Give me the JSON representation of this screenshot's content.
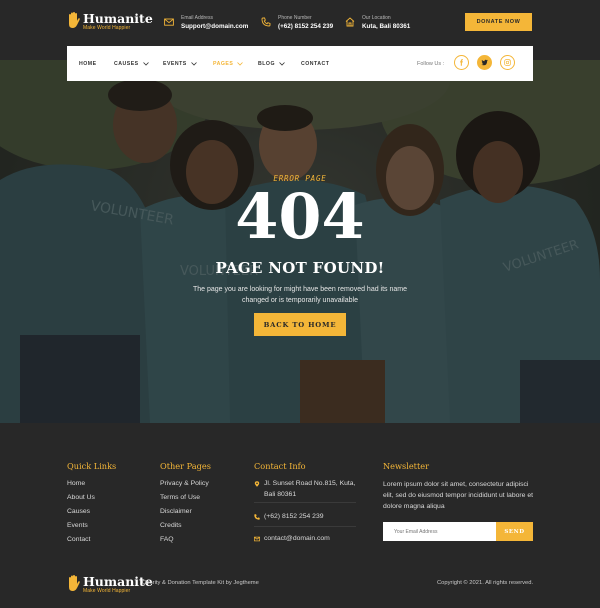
{
  "brand": {
    "name": "Humanite",
    "tagline": "Make World Happier",
    "accent": "#f4b638"
  },
  "topbar": {
    "email": {
      "icon": "mail-icon",
      "label": "Email Address",
      "value": "Support@domain.com"
    },
    "phone": {
      "icon": "phone-icon",
      "label": "Phone Number",
      "value": "(+62) 8152 254 239"
    },
    "location": {
      "icon": "home-icon",
      "label": "Our Location",
      "value": "Kuta, Bali 80361"
    },
    "donate_label": "DONATE NOW"
  },
  "nav": {
    "items": [
      {
        "label": "HOME",
        "dropdown": false,
        "active": false
      },
      {
        "label": "CAUSES",
        "dropdown": true,
        "active": false
      },
      {
        "label": "EVENTS",
        "dropdown": true,
        "active": false
      },
      {
        "label": "PAGES",
        "dropdown": true,
        "active": true
      },
      {
        "label": "BLOG",
        "dropdown": true,
        "active": false
      },
      {
        "label": "CONTACT",
        "dropdown": false,
        "active": false
      }
    ],
    "follow_label": "Follow Us :",
    "socials": [
      "facebook-icon",
      "twitter-icon",
      "instagram-icon"
    ]
  },
  "hero": {
    "eyebrow": "ERROR PAGE",
    "code": "404",
    "title": "PAGE NOT FOUND!",
    "description": "The page you are looking for might have been removed had its name changed or is temporarily unavailable",
    "button_label": "BACK TO HOME",
    "shirt_text": "VOLUNTEER"
  },
  "footer": {
    "quick_links": {
      "title": "Quick Links",
      "items": [
        "Home",
        "About Us",
        "Causes",
        "Events",
        "Contact"
      ]
    },
    "other_pages": {
      "title": "Other Pages",
      "items": [
        "Privacy & Policy",
        "Terms of Use",
        "Disclaimer",
        "Credits",
        "FAQ"
      ]
    },
    "contact_info": {
      "title": "Contact Info",
      "address": "Jl. Sunset Road No.815, Kuta, Bali 80361",
      "phone": "(+62) 8152 254 239",
      "email": "contact@domain.com"
    },
    "newsletter": {
      "title": "Newsletter",
      "text": "Lorem ipsum dolor sit amet, consectetur adipisci elit, sed do eiusmod tempor incididunt ut labore et dolore magna aliqua",
      "placeholder": "Your Email Address",
      "button_label": "SEND"
    },
    "credit": "Charity & Donation Template Kit by Jegtheme",
    "copyright": "Copyright © 2021. All rights reserved."
  }
}
